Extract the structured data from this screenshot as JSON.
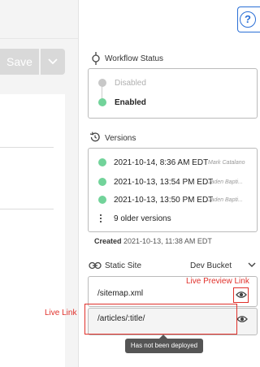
{
  "toolbar": {
    "save_label": "Save"
  },
  "workflow": {
    "heading": "Workflow Status",
    "states": [
      {
        "label": "Disabled",
        "active": false
      },
      {
        "label": "Enabled",
        "active": true
      }
    ]
  },
  "versions": {
    "heading": "Versions",
    "items": [
      {
        "date": "2021-10-14, 8:36 AM EDT",
        "author": "Mark Catalano"
      },
      {
        "date": "2021-10-13, 13:54 PM EDT",
        "author": "Jaden Bapti..."
      },
      {
        "date": "2021-10-13, 13:50 PM EDT",
        "author": "Jaden Bapti..."
      }
    ],
    "older": "9 older versions",
    "created_label": "Created",
    "created_value": "2021-10-13, 11:38 AM EDT"
  },
  "static_site": {
    "heading": "Static Site",
    "bucket": "Dev Bucket",
    "links": [
      {
        "path": "/sitemap.xml"
      },
      {
        "path": "/articles/:title/"
      }
    ],
    "tooltip": "Has not been deployed"
  },
  "annotations": {
    "live_preview_link": "Live Preview Link",
    "live_link": "Live Link"
  },
  "colors": {
    "accent": "#2a6fd6",
    "status_green": "#72d39a",
    "annotation_red": "#e0302a"
  },
  "icons": [
    "help-icon",
    "workflow-icon",
    "history-icon",
    "link-icon",
    "chevron-down-icon",
    "eye-icon",
    "more-vertical-icon"
  ]
}
